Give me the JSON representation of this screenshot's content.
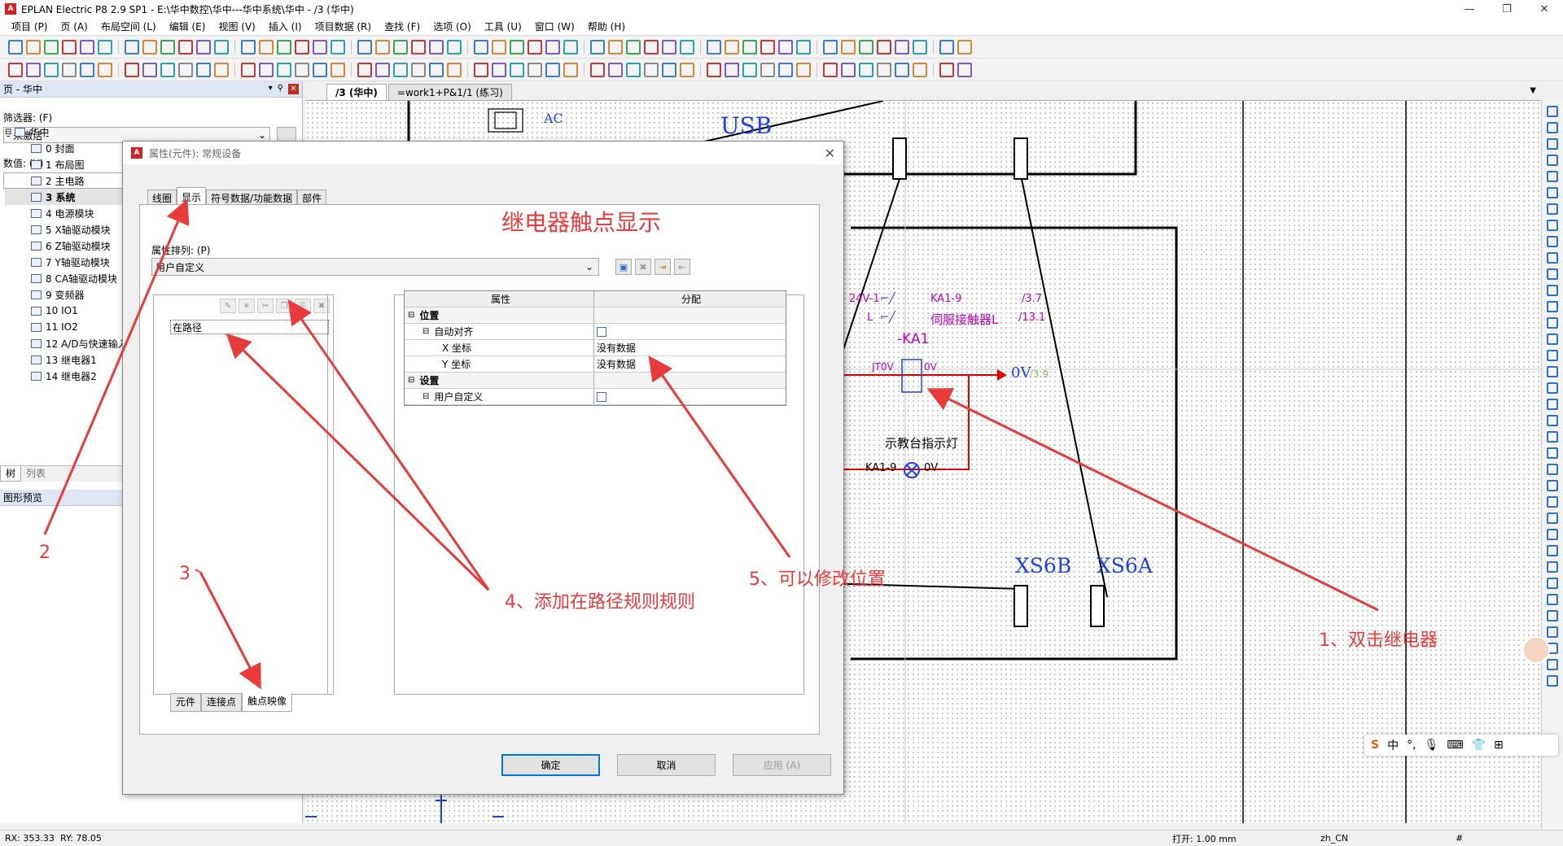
{
  "app": {
    "title": "EPLAN Electric P8 2.9 SP1 - E:\\华中数控\\华中---华中系统\\华中 - /3 (华中)",
    "logo_text": "A"
  },
  "menu": [
    "项目 (P)",
    "页 (A)",
    "布局空间 (L)",
    "编辑 (E)",
    "视图 (V)",
    "插入 (I)",
    "项目数据 (R)",
    "查找 (F)",
    "选项 (O)",
    "工具 (U)",
    "窗口 (W)",
    "帮助 (H)"
  ],
  "left_panel": {
    "header": "页 - 华中",
    "filter_label": "筛选器: (F)",
    "filter_value": "- 未激活 -",
    "value_label": "数值: (V)",
    "tree_root": "华中",
    "pages": [
      "0 封面",
      "1 布局图",
      "2 主电路",
      "3 系统",
      "4 电源模块",
      "5 X轴驱动模块",
      "6 Z轴驱动模块",
      "7 Y轴驱动模块",
      "8 CA轴驱动模块",
      "9 变频器",
      "10 IO1",
      "11 IO2",
      "12 A/D与快速输入",
      "13 继电器1",
      "14 继电器2"
    ],
    "bottom_tabs": [
      "树",
      "列表"
    ],
    "preview_header": "图形预览"
  },
  "doc_tabs": [
    "/3 (华中)",
    "=work1+P&1/1 (练习)"
  ],
  "canvas": {
    "labels": {
      "usb": "USB",
      "ac": "AC",
      "coil_line1": "24V-1",
      "coil_line1b": "KA1-9",
      "coil_ref1": "/3.7",
      "coil_line2": "L",
      "coil_line2b": "伺服接触器L",
      "coil_ref2": "/13.1",
      "relay": "-KA1",
      "jt0v": "JT0V",
      "zero_v": "0V",
      "zero_v_big": "0V",
      "zero_v_ref": "/3.9",
      "lamp_name": "示教台指示灯",
      "lamp_in": "KA1-9",
      "lamp_out": "0V",
      "xs6b": "XS6B",
      "xs6a": "XS6A"
    }
  },
  "dialog": {
    "title": "属性(元件): 常规设备",
    "tabs": [
      "线圈",
      "显示",
      "符号数据/功能数据",
      "部件"
    ],
    "heading": "继电器触点显示",
    "arrangement_label": "属性排列: (P)",
    "arrangement_value": "用户自定义",
    "list_item": "在路径",
    "grid_headers": [
      "属性",
      "分配"
    ],
    "grid_rows": [
      {
        "name": "位置",
        "value": "",
        "level": 0,
        "bold": true
      },
      {
        "name": "自动对齐",
        "value": "",
        "level": 1,
        "check": true
      },
      {
        "name": "X 坐标",
        "value": "没有数据",
        "level": 2
      },
      {
        "name": "Y 坐标",
        "value": "没有数据",
        "level": 2
      },
      {
        "name": "设置",
        "value": "",
        "level": 0,
        "bold": true
      },
      {
        "name": "用户自定义",
        "value": "",
        "level": 1,
        "check": true
      }
    ],
    "bottom_tabs": [
      "元件",
      "连接点",
      "触点映像"
    ],
    "buttons": {
      "ok": "确定",
      "cancel": "取消",
      "apply": "应用 (A)"
    }
  },
  "annotations": {
    "a1": "1、双击继电器",
    "a2": "2",
    "a3": "3",
    "a4": "4、添加在路径规则规则",
    "a5": "5、可以修改位置"
  },
  "status": {
    "rx": "RX: 353.33",
    "ry": "RY: 78.05",
    "grid": "打开: 1.00 mm",
    "lang": "zh_CN",
    "hash": "#"
  },
  "ime": {
    "mode": "中"
  },
  "colors": {
    "annotation": "#e83c3c",
    "wire_red": "#e00000",
    "magenta": "#c000c0",
    "blue": "#2040e0"
  }
}
